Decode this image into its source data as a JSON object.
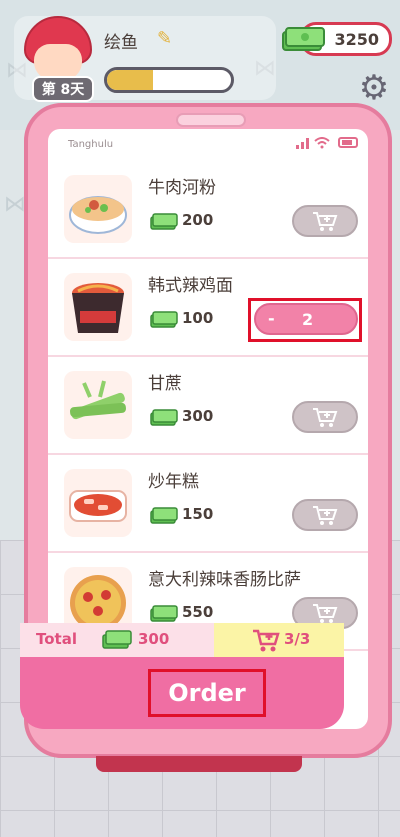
{
  "player": {
    "name": "绘鱼",
    "day_badge": "第 8天",
    "xp_fraction": 0.37
  },
  "wallet": {
    "money": "3250"
  },
  "screen": {
    "carrier": "Tanghulu"
  },
  "items": [
    {
      "name": "牛肉河粉",
      "price": "200",
      "action": "cart"
    },
    {
      "name": "韩式辣鸡面",
      "price": "100",
      "action": "stepper",
      "qty": "2",
      "minus": "-"
    },
    {
      "name": "甘蔗",
      "price": "300",
      "action": "cart"
    },
    {
      "name": "炒年糕",
      "price": "150",
      "action": "cart"
    },
    {
      "name": "意大利辣味香肠比萨",
      "price": "550",
      "action": "cart"
    }
  ],
  "footer": {
    "total_label": "Total",
    "total_value": "300",
    "cart_count": "3/3",
    "order_label": "Order"
  },
  "colors": {
    "accent_pink": "#f06ea3",
    "highlight_red": "#e0102a",
    "cash_green": "#7dd16a"
  },
  "icons": [
    "pencil-icon",
    "cash-icon",
    "gear-icon",
    "cart-icon",
    "signal-icon",
    "wifi-icon",
    "battery-icon"
  ]
}
